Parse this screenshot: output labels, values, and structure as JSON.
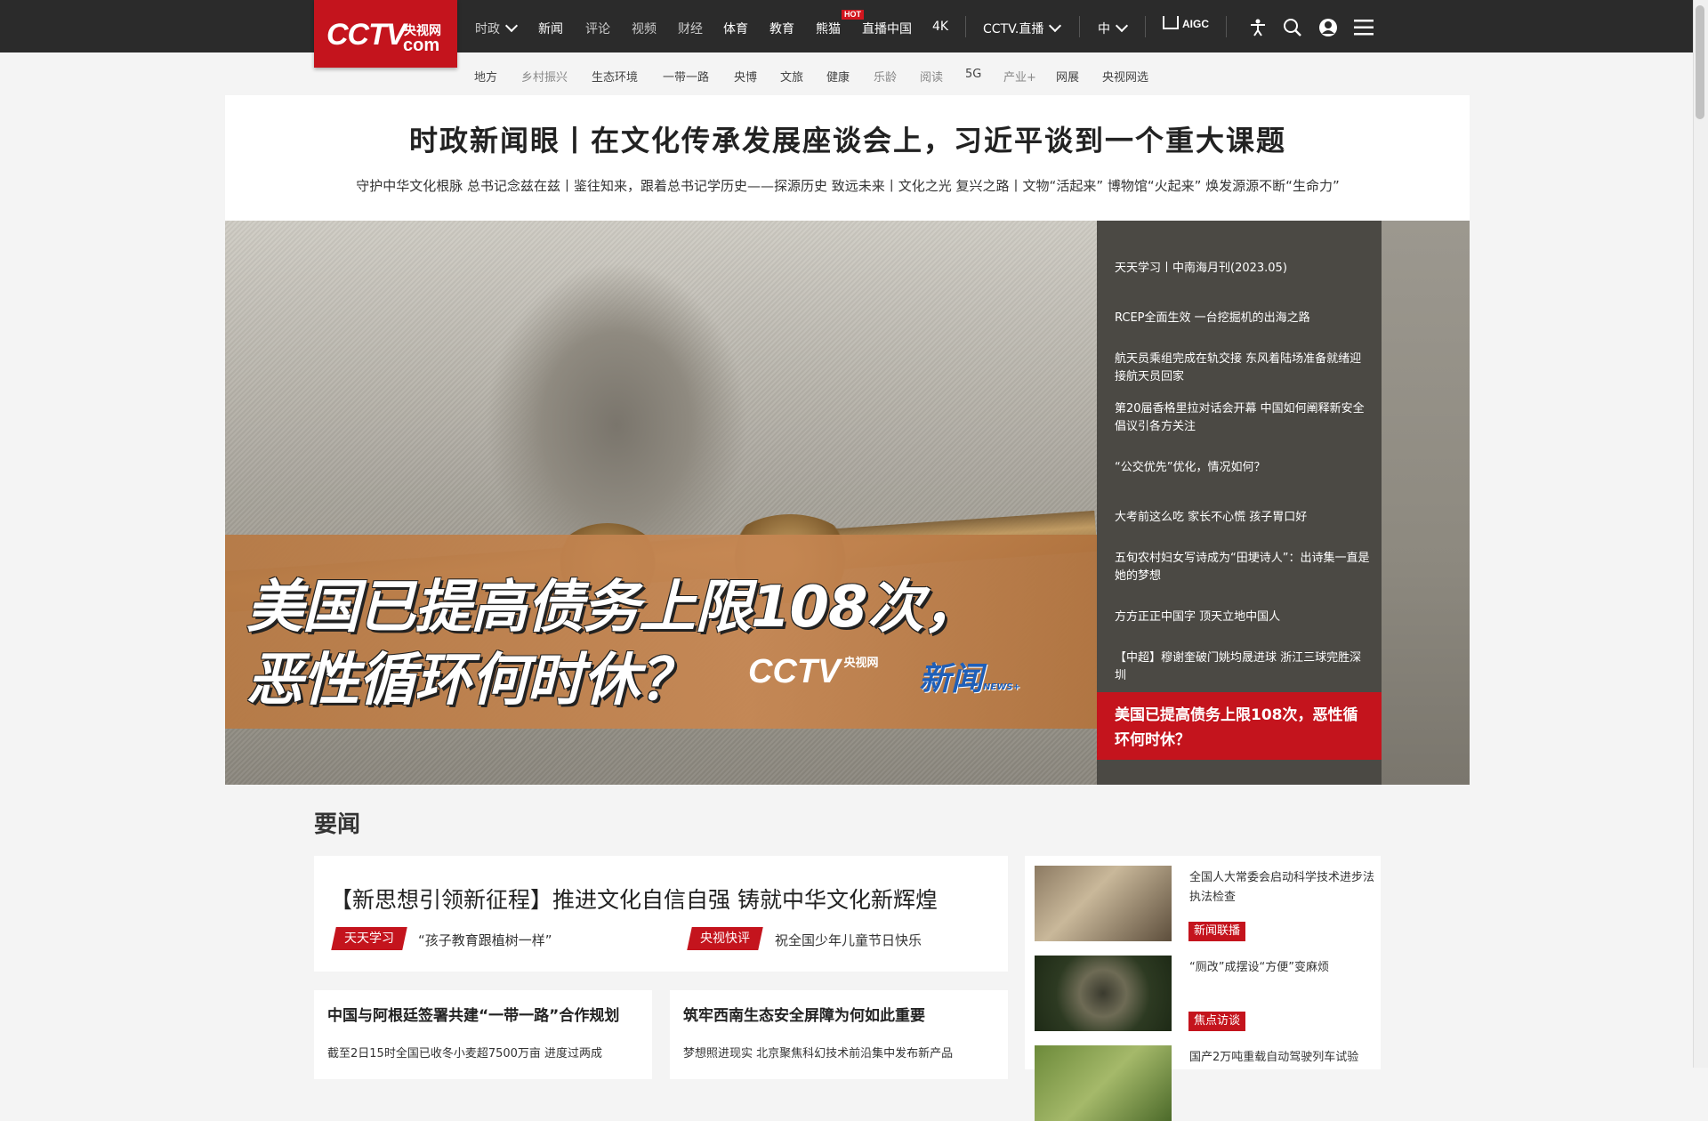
{
  "brand": {
    "logo_en": "CCTV",
    "logo_cn": "央视网",
    "logo_com": "com"
  },
  "nav": {
    "items": [
      "时政",
      "新闻",
      "评论",
      "视频",
      "财经",
      "体育",
      "教育",
      "熊猫",
      "直播中国",
      "4K"
    ],
    "hot_badge": "HOT",
    "live": "CCTV.直播",
    "lang": "中",
    "aigc": "AIGC"
  },
  "subnav": [
    "地方",
    "乡村振兴",
    "生态环境",
    "一带一路",
    "央博",
    "文旅",
    "健康",
    "乐龄",
    "阅读",
    "5G",
    "产业+",
    "网展",
    "央视网选"
  ],
  "headline": {
    "title": "时政新闻眼丨在文化传承发展座谈会上，习近平谈到一个重大课题",
    "sublinks": "守护中华文化根脉 总书记念兹在兹丨鉴往知来，跟着总书记学历史——探源历史 致远未来丨文化之光 复兴之路丨文物“活起来” 博物馆“火起来” 焕发源源不断“生命力”"
  },
  "hero": {
    "banner_line1": "美国已提高债务上限108次，",
    "banner_line2": "恶性循环何时休？",
    "banner_logo": "CCTV",
    "banner_logo_cn": "央视网",
    "banner_news": "新闻",
    "banner_news_sub": "NEWS+",
    "list": [
      "天天学习丨中南海月刊(2023.05)",
      "RCEP全面生效 一台挖掘机的出海之路",
      "航天员乘组完成在轨交接 东风着陆场准备就绪迎接航天员回家",
      "第20届香格里拉对话会开幕 中国如何阐释新安全倡议引各方关注",
      "“公交优先”优化，情况如何？",
      "大考前这么吃 家长不心慌 孩子胃口好",
      "五旬农村妇女写诗成为“田埂诗人”：出诗集一直是她的梦想",
      "方方正正中国字 顶天立地中国人",
      "【中超】穆谢奎破门姚均晟进球 浙江三球完胜深圳"
    ],
    "active": "美国已提高债务上限108次，恶性循环何时休？"
  },
  "news": {
    "section_title": "要闻",
    "top_title": "【新思想引领新征程】推进文化自信自强 铸就中华文化新辉煌",
    "tag1": "天天学习",
    "tag1_text": "“孩子教育跟植树一样”",
    "tag2": "央视快评",
    "tag2_text": "祝全国少年儿童节日快乐",
    "card1_title": "中国与阿根廷签署共建“一带一路”合作规划",
    "card1_desc": "截至2日15时全国已收冬小麦超7500万亩 进度过两成",
    "card2_title": "筑牢西南生态安全屏障为何如此重要",
    "card2_desc": "梦想照进现实 北京聚焦科幻技术前沿集中发布新产品"
  },
  "sidebar": {
    "items": [
      {
        "title": "全国人大常委会启动科学技术进步法执法检查",
        "tag": "新闻联播"
      },
      {
        "title": "“厕改”成摆设“方便”变麻烦",
        "tag": "焦点访谈"
      },
      {
        "title": "国产2万吨重载自动驾驶列车试验"
      }
    ]
  },
  "colors": {
    "brand_red": "#c4141d",
    "topbar": "#2b2b2b",
    "hero_panel": "#3c3a34"
  }
}
